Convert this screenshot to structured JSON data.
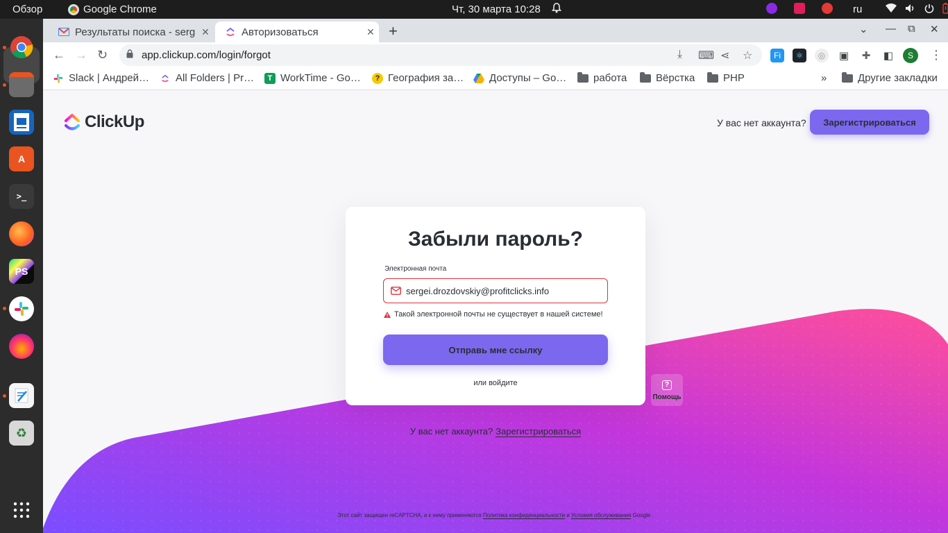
{
  "system_bar": {
    "overview": "Обзор",
    "app_name": "Google Chrome",
    "datetime": "Чт, 30 марта  10:28",
    "language": "ru"
  },
  "browser": {
    "tabs": [
      {
        "title": "Результаты поиска - serg",
        "icon": "gmail-icon"
      },
      {
        "title": "Авторизоваться",
        "icon": "clickup-icon"
      }
    ],
    "url": "app.clickup.com/login/forgot",
    "profile_initial": "S",
    "bookmarks": [
      "Slack | Андрей…",
      "All Folders | Pr…",
      "WorkTime - Go…",
      "География за…",
      "Доступы – Go…",
      "работа",
      "Вёрстка",
      "PHP"
    ],
    "other_bookmarks": "Другие закладки",
    "overflow": "»"
  },
  "header": {
    "logo_text": "ClickUp",
    "no_account": "У вас нет аккаунта?",
    "signup_button": "Зарегистрироваться"
  },
  "form": {
    "title": "Забыли пароль?",
    "email_label": "Электронная почта",
    "email_value": "sergei.drozdovskiy@profitclicks.info",
    "error": "Такой электронной почты не существует в нашей системе!",
    "submit": "Отправь мне ссылку",
    "login_link": "или войдите"
  },
  "help": {
    "label": "Помощь"
  },
  "footer": {
    "no_account": "У вас нет аккаунта?",
    "signup_link": "Зарегистрироваться",
    "recaptcha_prefix": "Этот сайт защищен reCAPTCHA, и к нему применяются",
    "privacy": "Политика конфиденциальности",
    "and": "и",
    "terms": "Условия обслуживания",
    "suffix": "Google ."
  },
  "colors": {
    "brand_purple": "#7b68ee",
    "error_red": "#e0303b",
    "wave_start": "#7b4dff",
    "wave_end": "#ff4f9a"
  }
}
